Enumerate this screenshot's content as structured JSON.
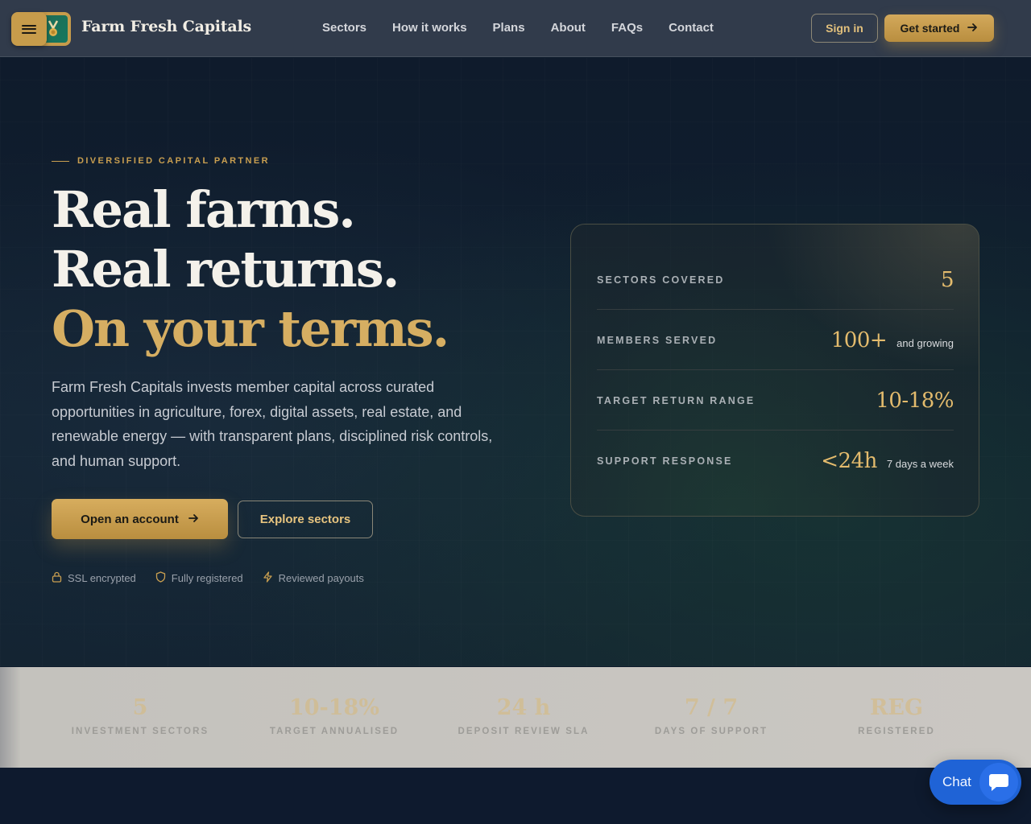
{
  "nav": {
    "brand": "Farm Fresh Capitals",
    "links": [
      "Sectors",
      "How it works",
      "Plans",
      "About",
      "FAQs",
      "Contact"
    ],
    "sign_in": "Sign in",
    "get_started": "Get started"
  },
  "hero": {
    "eyebrow": "DIVERSIFIED CAPITAL PARTNER",
    "headline_1": "Real farms.",
    "headline_2": "Real returns.",
    "headline_3": "On your terms.",
    "lead": "Farm Fresh Capitals invests member capital across curated opportunities in agriculture, forex, digital assets, real estate, and renewable energy — with transparent plans, disciplined risk controls, and human support.",
    "cta_primary": "Open an account",
    "cta_secondary": "Explore sectors",
    "trust": [
      "SSL encrypted",
      "Fully registered",
      "Reviewed payouts"
    ]
  },
  "card": {
    "rows": [
      {
        "label": "SECTORS COVERED",
        "value": "5",
        "sub": ""
      },
      {
        "label": "MEMBERS SERVED",
        "value": "100+",
        "sub": "and growing"
      },
      {
        "label": "TARGET RETURN RANGE",
        "value": "10-18%",
        "sub": ""
      },
      {
        "label": "SUPPORT RESPONSE",
        "value": "<24h",
        "sub": "7 days a week"
      }
    ]
  },
  "stats": [
    {
      "value": "5",
      "label": "INVESTMENT SECTORS"
    },
    {
      "value": "10-18%",
      "label": "TARGET ANNUALISED"
    },
    {
      "value": "24 h",
      "label": "DEPOSIT REVIEW SLA"
    },
    {
      "value": "7 / 7",
      "label": "DAYS OF SUPPORT"
    },
    {
      "value": "REG",
      "label": "REGISTERED"
    }
  ],
  "chat": {
    "label": "Chat"
  },
  "icons": {
    "menu": "menu-icon",
    "logo": "medal-icon",
    "arrow": "arrow-right-icon",
    "lock": "lock-icon",
    "shield": "shield-icon",
    "bolt": "bolt-icon",
    "chat": "chat-bubble-icon"
  },
  "colors": {
    "accent_gold": "#c99f50",
    "background": "#0d1a2b",
    "chat_blue": "#1f63d6"
  }
}
